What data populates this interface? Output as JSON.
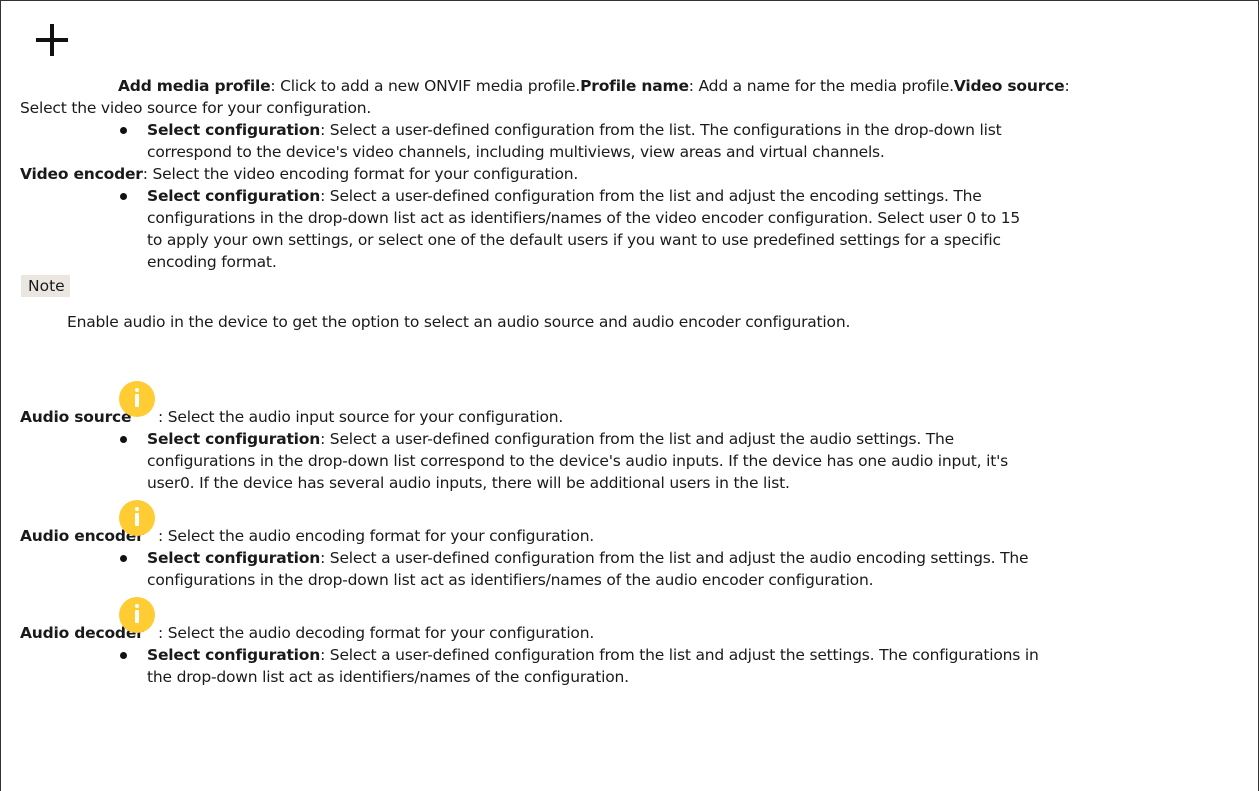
{
  "add_profile": {
    "label": "Add media profile",
    "desc": ": Click to add a new ONVIF media profile.",
    "profile_name_label": "Profile name",
    "profile_name_desc": ": Add a name for the media profile.",
    "video_source_label": "Video source",
    "video_source_desc_1": ":",
    "video_source_desc_2": "Select the video source for your configuration."
  },
  "video_source_bullet": {
    "label": "Select configuration",
    "line1": ": Select a user-defined configuration from the list. The configurations in the drop-down list",
    "line2": "correspond to the device's video channels, including multiviews, view areas and virtual channels."
  },
  "video_encoder": {
    "label": "Video encoder",
    "desc": ": Select the video encoding format for your configuration."
  },
  "video_encoder_bullet": {
    "label": "Select configuration",
    "line1": ": Select a user-defined configuration from the list and adjust the encoding settings. The",
    "line2": "configurations in the drop-down list act as identifiers/names of the video encoder configuration. Select user 0 to 15",
    "line3": "to apply your own settings, or select one of the default users if you want to use predefined settings for a specific",
    "line4": "encoding format."
  },
  "note": {
    "badge": "Note",
    "text": "Enable audio in the device to get the option to select an audio source and audio encoder configuration."
  },
  "audio_source": {
    "label": "Audio source",
    "desc": ": Select the audio input source for your configuration.",
    "icon": "info-icon",
    "bullet_label": "Select configuration",
    "line1": ": Select a user-defined configuration from the list and adjust the audio settings. The",
    "line2": "configurations in the drop-down list correspond to the device's audio inputs. If the device has one audio input, it's",
    "line3": "user0. If the device has several audio inputs, there will be additional users in the list."
  },
  "audio_encoder": {
    "label": "Audio encoder",
    "desc": ": Select the audio encoding format for your configuration.",
    "icon": "info-icon",
    "bullet_label": "Select configuration",
    "line1": ": Select a user-defined configuration from the list and adjust the audio encoding settings. The",
    "line2": "configurations in the drop-down list act as identifiers/names of the audio encoder configuration."
  },
  "audio_decoder": {
    "label": "Audio decoder",
    "desc": ": Select the audio decoding format for your configuration.",
    "icon": "info-icon",
    "bullet_label": "Select configuration",
    "line1": ": Select a user-defined configuration from the list and adjust the settings. The configurations in",
    "line2": "the drop-down list act as identifiers/names of the configuration."
  },
  "colors": {
    "info_icon": "#ffcc33",
    "note_badge_bg": "#ebe6df",
    "text": "#1a1a1a"
  }
}
